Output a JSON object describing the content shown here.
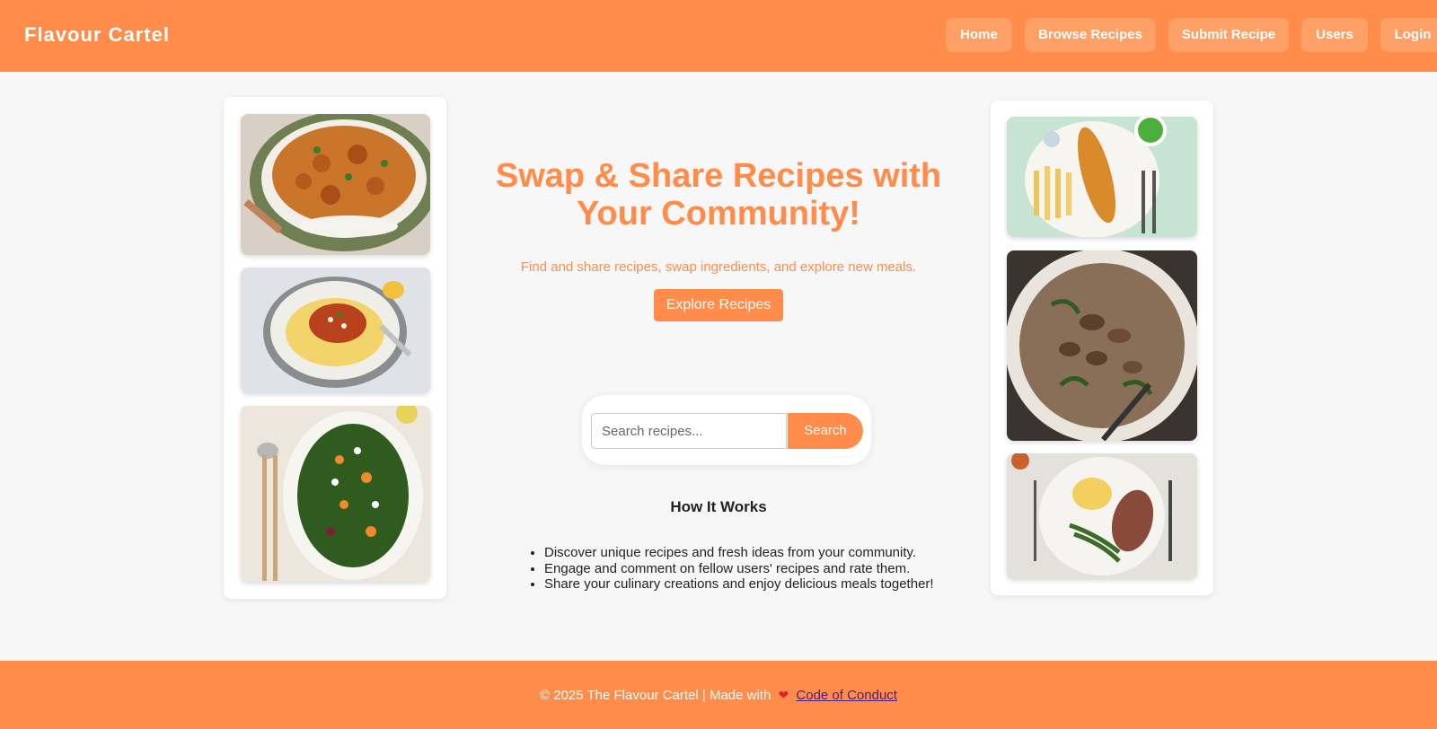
{
  "header": {
    "brand": "Flavour Cartel",
    "nav": [
      {
        "label": "Home"
      },
      {
        "label": "Browse Recipes"
      },
      {
        "label": "Submit Recipe"
      },
      {
        "label": "Users"
      },
      {
        "label": "Login"
      }
    ]
  },
  "hero": {
    "title": "Swap & Share Recipes with Your Community!",
    "subtitle": "Find and share recipes, swap ingredients, and explore new meals.",
    "cta": "Explore Recipes"
  },
  "search": {
    "placeholder": "Search recipes...",
    "button": "Search"
  },
  "how_it_works": {
    "title": "How It Works",
    "items": [
      "Discover unique recipes and fresh ideas from your community.",
      "Engage and comment on fellow users' recipes and rate them.",
      "Share your culinary creations and enjoy delicious meals together!"
    ]
  },
  "footer": {
    "text": "© 2025 The Flavour Cartel | Made with",
    "heart": "❤",
    "link": "Code of Conduct"
  },
  "colors": {
    "accent": "#ff8c4a",
    "background": "#f7f7f7",
    "link": "#4b1f7a"
  }
}
